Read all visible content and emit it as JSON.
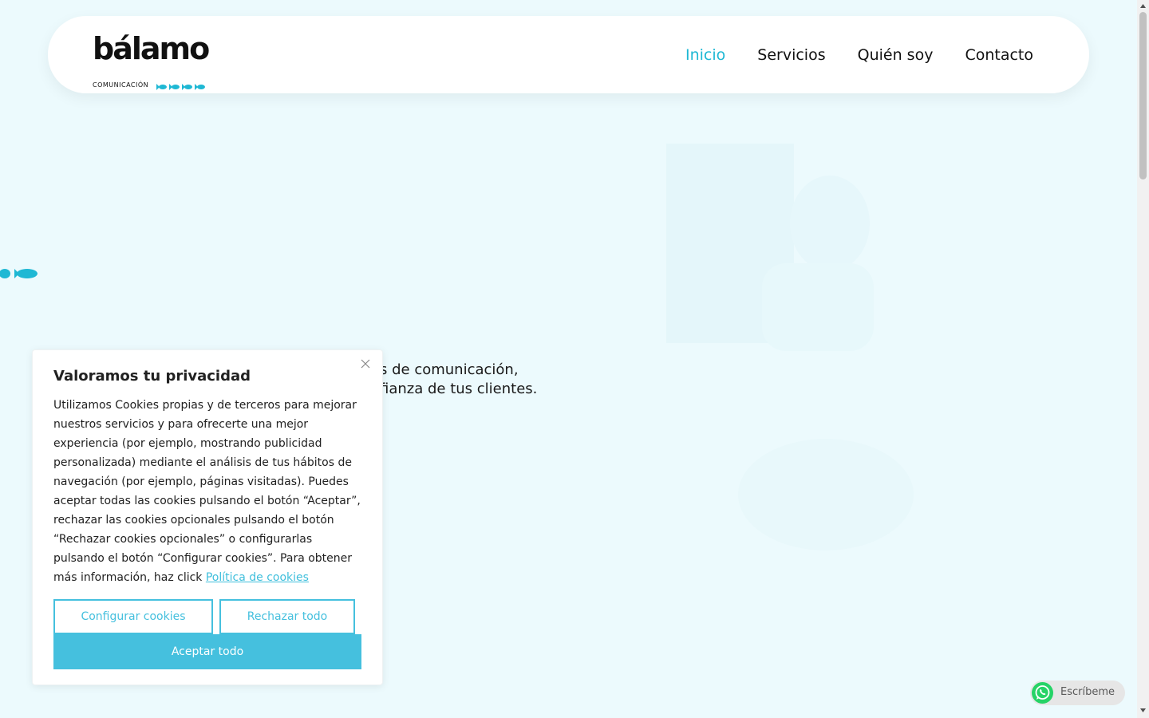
{
  "header": {
    "logo_text": "bálamo",
    "logo_subtext": "COMUNICACIÓN",
    "nav": [
      {
        "label": "Inicio",
        "active": true
      },
      {
        "label": "Servicios",
        "active": false
      },
      {
        "label": "Quién soy",
        "active": false
      },
      {
        "label": "Contacto",
        "active": false
      }
    ]
  },
  "hero": {
    "line1": "s de comunicación,",
    "line2": "fianza de tus clientes."
  },
  "cookie": {
    "title": "Valoramos tu privacidad",
    "body": "Utilizamos Cookies propias y de terceros para mejorar nuestros servicios y para ofrecerte una mejor experiencia (por ejemplo, mostrando publicidad personalizada) mediante el análisis de tus hábitos de navegación (por ejemplo, páginas visitadas). Puedes aceptar todas las cookies pulsando el botón “Aceptar”, rechazar las cookies opcionales pulsando el botón “Rechazar cookies opcionales” o configurarlas pulsando el botón “Configurar cookies”. Para obtener más información, haz click ",
    "policy_link": "Política de cookies",
    "config_label": "Configurar cookies",
    "reject_label": "Rechazar todo",
    "accept_label": "Aceptar todo"
  },
  "whatsapp": {
    "label": "Escríbeme"
  },
  "colors": {
    "accent": "#1fb8d4",
    "button": "#45c0de",
    "background": "#ecfafd"
  }
}
